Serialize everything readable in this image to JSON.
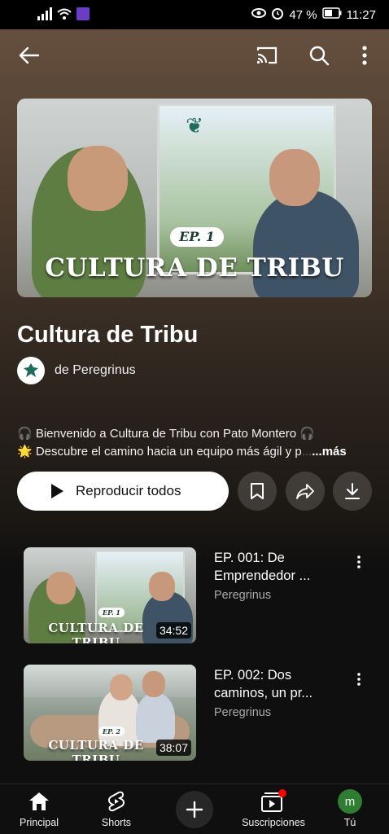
{
  "status_bar": {
    "battery": "47 %",
    "time": "11:27"
  },
  "app_bar": {
    "icons": [
      "back-arrow-icon",
      "cast-icon",
      "search-icon",
      "more-vert-icon"
    ]
  },
  "hero": {
    "episode_badge": "EP. 1",
    "overlay_title": "CULTURA DE TRIBU"
  },
  "playlist": {
    "title": "Cultura de Tribu",
    "channel": "de Peregrinus",
    "description_line1": "🎧 Bienvenido a Cultura de Tribu con Pato Montero 🎧",
    "description_line2_main": "🌟 Descubre el camino hacia un equipo más ágil y p",
    "description_line2_fade": "...",
    "more": "...más",
    "play_all_label": "Reproducir todos"
  },
  "videos": [
    {
      "title": "EP. 001: De Emprendedor ...",
      "channel": "Peregrinus",
      "duration": "34:52",
      "thumb_badge": "EP. 1",
      "thumb_title": "CULTURA DE TRIBU"
    },
    {
      "title": "EP. 002: Dos caminos, un pr...",
      "channel": "Peregrinus",
      "duration": "38:07",
      "thumb_badge": "EP. 2",
      "thumb_title": "CULTURA DE TRIBU"
    }
  ],
  "bottom_nav": {
    "home": "Principal",
    "shorts": "Shorts",
    "subscriptions": "Suscripciones",
    "you": "Tú",
    "you_avatar_letter": "m"
  },
  "colors": {
    "accent_red": "#ff0000",
    "avatar_green": "#2e7d32"
  }
}
